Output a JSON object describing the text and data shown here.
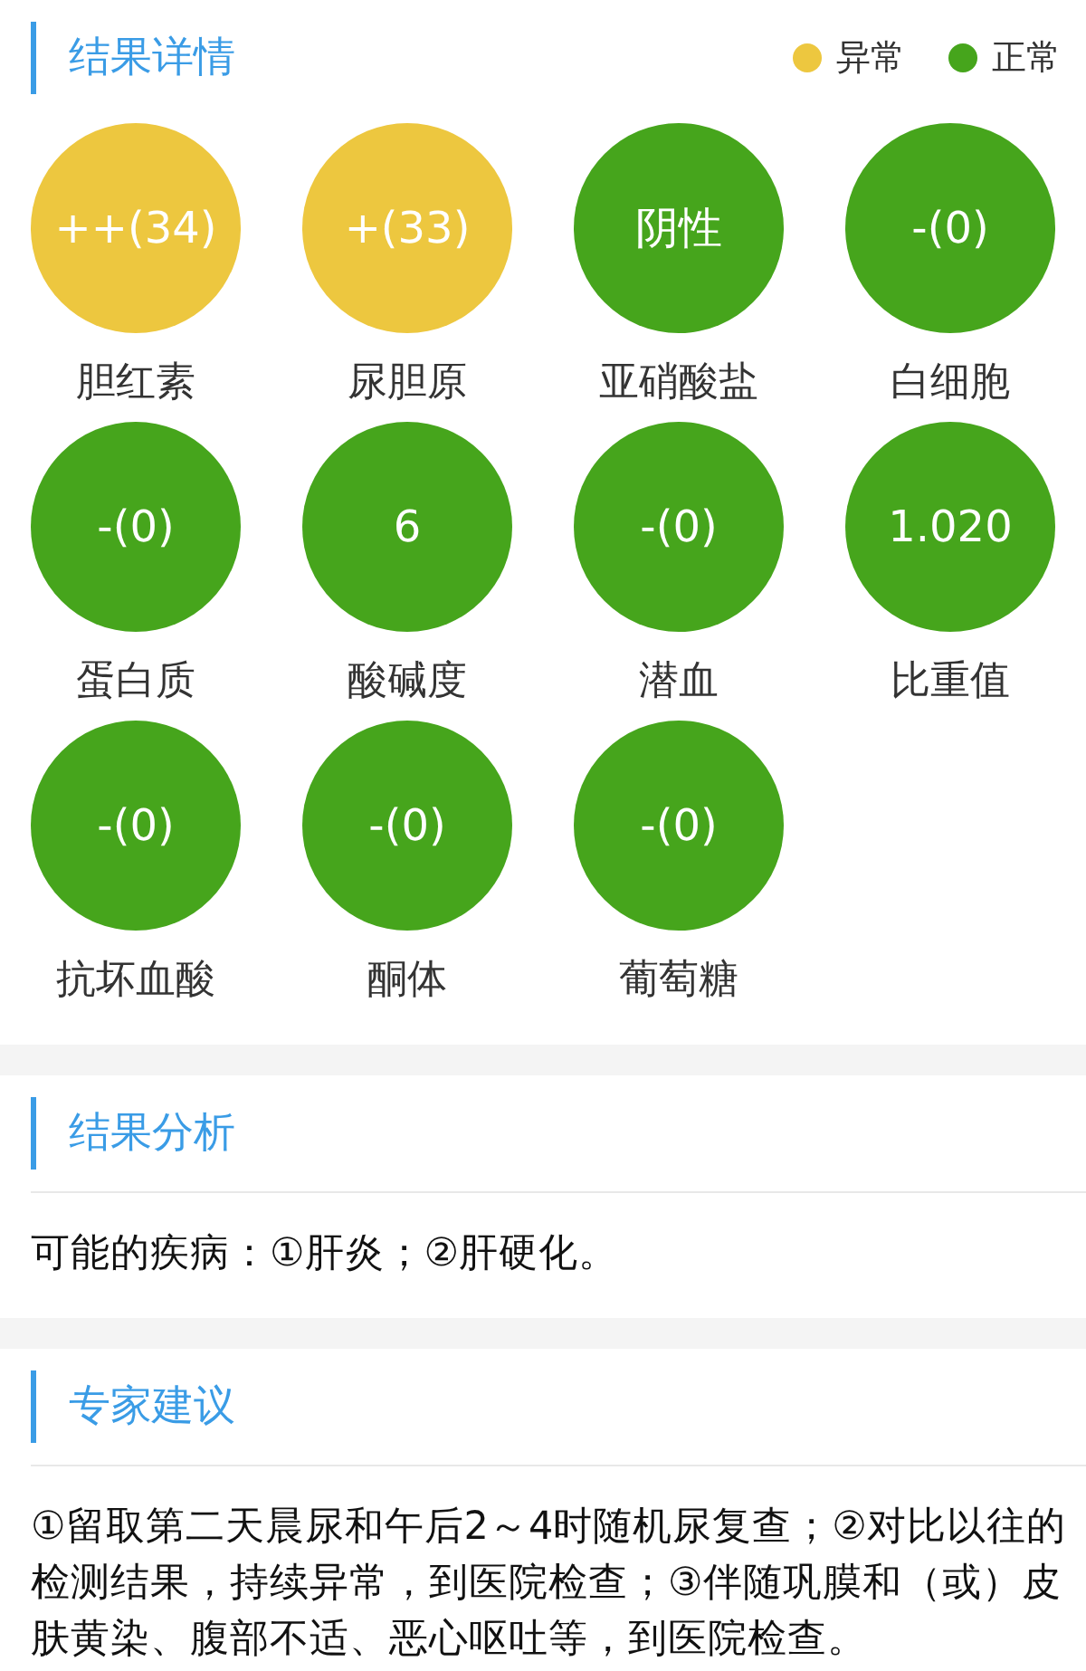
{
  "details": {
    "title": "结果详情",
    "legend": [
      {
        "label": "异常",
        "color": "#edc73f"
      },
      {
        "label": "正常",
        "color": "#46a51c"
      }
    ],
    "results": [
      {
        "value": "++(34)",
        "name": "胆红素",
        "color": "#edc73f"
      },
      {
        "value": "+(33)",
        "name": "尿胆原",
        "color": "#edc73f"
      },
      {
        "value": "阴性",
        "name": "亚硝酸盐",
        "color": "#46a51c"
      },
      {
        "value": "-(0)",
        "name": "白细胞",
        "color": "#46a51c"
      },
      {
        "value": "-(0)",
        "name": "蛋白质",
        "color": "#46a51c"
      },
      {
        "value": "6",
        "name": "酸碱度",
        "color": "#46a51c"
      },
      {
        "value": "-(0)",
        "name": "潜血",
        "color": "#46a51c"
      },
      {
        "value": "1.020",
        "name": "比重值",
        "color": "#46a51c"
      },
      {
        "value": "-(0)",
        "name": "抗坏血酸",
        "color": "#46a51c"
      },
      {
        "value": "-(0)",
        "name": "酮体",
        "color": "#46a51c"
      },
      {
        "value": "-(0)",
        "name": "葡萄糖",
        "color": "#46a51c"
      }
    ]
  },
  "analysis": {
    "title": "结果分析",
    "text": "可能的疾病：①肝炎；②肝硬化。"
  },
  "advice": {
    "title": "专家建议",
    "text": "①留取第二天晨尿和午后2～4时随机尿复查；②对比以往的检测结果，持续异常，到医院检查；③伴随巩膜和（或）皮肤黄染、腹部不适、恶心呕吐等，到医院检查。"
  }
}
